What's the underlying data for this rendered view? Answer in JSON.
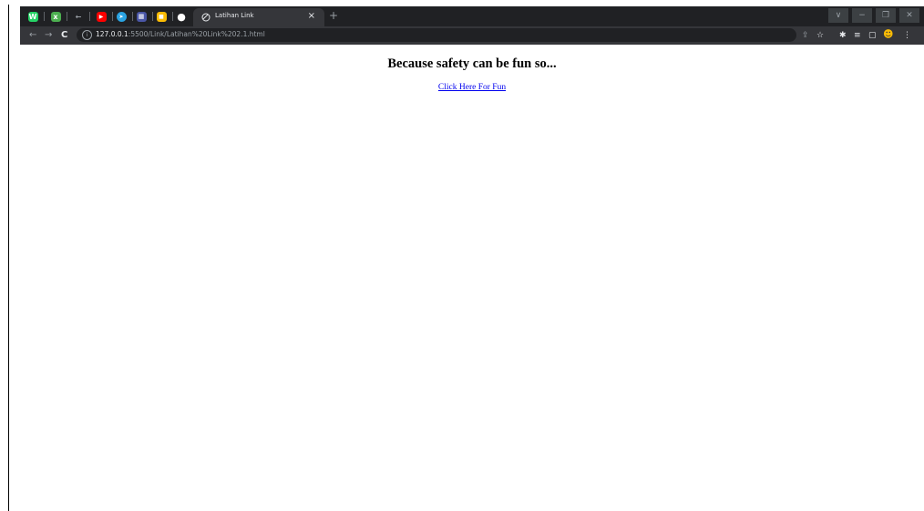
{
  "browser": {
    "tab": {
      "title": "Latihan Link",
      "close_glyph": "×"
    },
    "new_tab_glyph": "+",
    "pinned_tabs": [
      {
        "icon": "whatsapp-icon",
        "color": "#25d366",
        "glyph": "W"
      },
      {
        "icon": "xyz-icon",
        "color": "#4caf50",
        "glyph": "x"
      },
      {
        "icon": "arrow-icon",
        "color": "#5f6368",
        "glyph": "←"
      },
      {
        "icon": "youtube-icon",
        "color": "#ff0000",
        "glyph": "▶"
      },
      {
        "icon": "telegram-icon",
        "color": "#2aa3e2",
        "glyph": "➤"
      },
      {
        "icon": "app-icon",
        "color": "#4a56a6",
        "glyph": "▦"
      },
      {
        "icon": "keep-icon",
        "color": "#fbbc04",
        "glyph": "■"
      },
      {
        "icon": "github-icon",
        "color": "#ffffff",
        "glyph": "●"
      }
    ],
    "window_controls": {
      "menu": "∨",
      "minimize": "−",
      "restore": "❐",
      "close": "✕"
    },
    "toolbar": {
      "back": "←",
      "forward": "→",
      "reload": "C",
      "info": "i",
      "url_host": "127.0.0.1",
      "url_path": ":5500/Link/Latihan%20Link%202.1.html",
      "icons": {
        "share": "⇪",
        "bookmark": "☆",
        "extensions": "✱",
        "reading_list": "≡",
        "side_panel": "▢",
        "profile": "☻",
        "menu": "⋮"
      }
    }
  },
  "page": {
    "heading": "Because safety can be fun so...",
    "link_text": "Click Here For Fun"
  }
}
